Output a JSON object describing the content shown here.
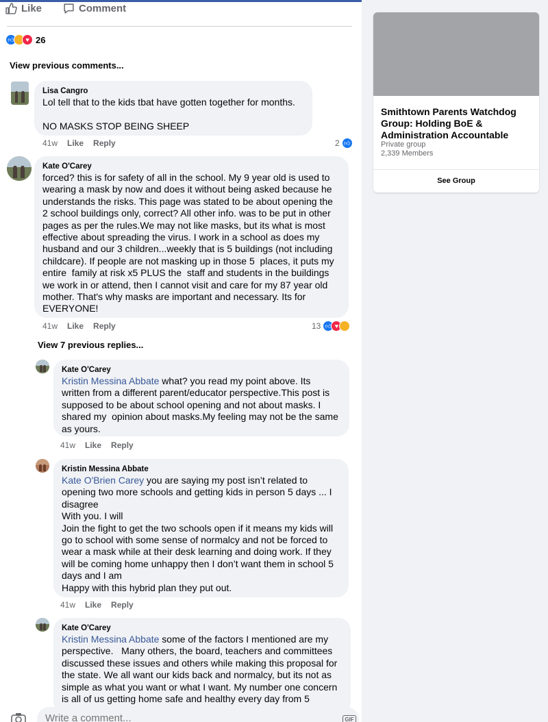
{
  "post_actions": {
    "like_label": "Like",
    "comment_label": "Comment"
  },
  "reactions": {
    "count": "26"
  },
  "view_previous_comments": "View previous comments...",
  "comments": [
    {
      "author": "Lisa Cangro",
      "text": "Lol tell that to the kids tbat have gotten together for months.\n\nNO MASKS STOP BEING SHEEP",
      "time": "41w",
      "like": "Like",
      "reply": "Reply",
      "reaction_count": "2"
    },
    {
      "author": "Kate O'Carey",
      "text": "forced? this is for safety of all in the school. My 9 year old is used to wearing a mask by now and does it without being asked because he understands the risks. This page was stated to be about opening the 2 school buildings only, correct? All other info. was to be put in other pages as per the rules.We may not like masks, but its what is most effective about spreading the virus. I work in a school as does my husband and our 3 children...weekly that is 5 buildings (not including childcare). If people are not masking up in those 5  places, it puts my entire  family at risk x5 PLUS the  staff and students in the buildings we work in or attend, then I cannot visit and care for my 87 year old mother. That's why masks are important and necessary. Its for EVERYONE!",
      "time": "41w",
      "like": "Like",
      "reply": "Reply",
      "reaction_count": "13"
    }
  ],
  "view_replies": "View 7 previous replies...",
  "replies": [
    {
      "author": "Kate O'Carey",
      "mention": "Kristin Messina Abbate",
      "text": " what? you read my point above. Its written from a different parent/educator perspective.This post is supposed to be about school opening and not about masks. I shared my  opinion about masks.My feeling may not be the same as yours.",
      "time": "41w",
      "like": "Like",
      "reply": "Reply"
    },
    {
      "author": "Kristin Messina Abbate",
      "mention": "Kate O'Brien Carey",
      "text": " you are saying my post isn’t related to opening two more schools and getting kids in person 5 days ... I disagree\nWith you. I will\nJoin the fight to get the two schools open if it means my kids will go to school with some sense of normalcy and not be forced to wear a mask while at their desk learning and doing work. If they will be coming home unhappy then I don’t want them in school 5 days and I am\nHappy with this hybrid plan they put out.",
      "time": "41w",
      "like": "Like",
      "reply": "Reply"
    },
    {
      "author": "Kate O'Carey",
      "mention": "Kristin Messina Abbate",
      "text": " some of the factors I mentioned are my perspective.   Many others, the board, teachers and committees discussed these issues and others while making this proposal for the state. We all want our kids back and normalcy, but its not as simple as what you want or what I want. My number one concern is all of us getting home safe and healthy every day from 5",
      "time": "",
      "like": "",
      "reply": ""
    }
  ],
  "comment_input": {
    "placeholder": "Write a comment...",
    "gif_label": "GIF"
  },
  "group": {
    "name": "Smithtown Parents Watchdog Group: Holding BoE & Administration Accountable",
    "type": "Private group",
    "members": "2,339 Members",
    "button": "See Group"
  },
  "colors": {
    "accent": "#1877f2",
    "mention": "#385898",
    "bubble": "#f0f2f5",
    "rail": "#f0f2f5",
    "meta": "#65676b"
  },
  "icons": [
    "thumbs-up-icon",
    "comment-icon",
    "like-reaction-icon",
    "care-reaction-icon",
    "love-reaction-icon",
    "haha-reaction-icon",
    "camera-icon",
    "gif-icon",
    "emoji-icon"
  ]
}
